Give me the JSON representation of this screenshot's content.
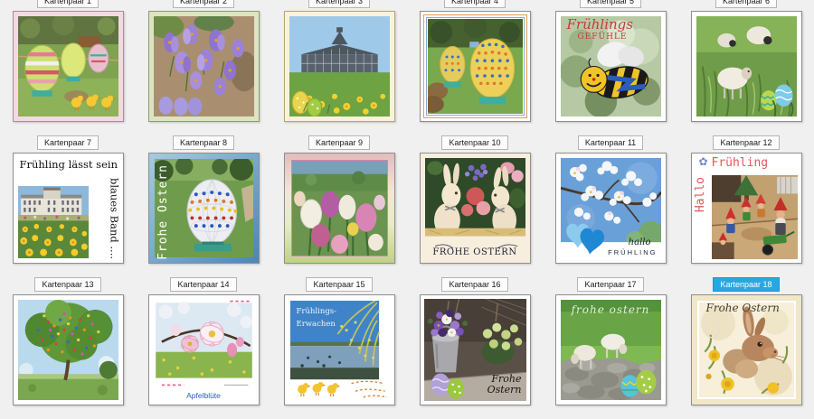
{
  "ui": {
    "background": "#f0f0f0",
    "label_bg": "#fcfcfc",
    "label_border": "#b4b4b4",
    "selected_bg": "#29a8e0",
    "selected_text": "#ffffff"
  },
  "cards": [
    {
      "label": "Kartenpaar 1",
      "alt": "decorated-easter-eggs-garden-chicks"
    },
    {
      "label": "Kartenpaar 2",
      "alt": "purple-crocus-field-eggs"
    },
    {
      "label": "Kartenpaar 3",
      "alt": "glasshouse-daffodils-eggs"
    },
    {
      "label": "Kartenpaar 4",
      "alt": "yellow-wire-eggs-lawn"
    },
    {
      "label": "Kartenpaar 5",
      "alt": "spring-bee-card",
      "texts": {
        "title": "Frühlings",
        "subtitle": "GEFÜHLE"
      }
    },
    {
      "label": "Kartenpaar 6",
      "alt": "sheep-meadow-eggs"
    },
    {
      "label": "Kartenpaar 7",
      "alt": "daffodils-palace-card",
      "texts": {
        "top": "Frühling lässt sein",
        "side": "blaues Band ...."
      }
    },
    {
      "label": "Kartenpaar 8",
      "alt": "bead-egg-card",
      "texts": {
        "side": "Frohe Ostern"
      }
    },
    {
      "label": "Kartenpaar 9",
      "alt": "tulip-field-card"
    },
    {
      "label": "Kartenpaar 10",
      "alt": "bunny-figurines-card",
      "texts": {
        "bottom": "FROHE OSTERN"
      }
    },
    {
      "label": "Kartenpaar 11",
      "alt": "apple-blossom-hearts-card",
      "texts": {
        "script": "hallo",
        "caps": "FRÜHLING"
      }
    },
    {
      "label": "Kartenpaar 12",
      "alt": "garden-gnomes-card",
      "texts": {
        "top": "Frühling",
        "side": "Hallo"
      }
    },
    {
      "label": "Kartenpaar 13",
      "alt": "easter-egg-tree"
    },
    {
      "label": "Kartenpaar 14",
      "alt": "apple-blossom-card",
      "texts": {
        "caption": "Apfelblüte"
      }
    },
    {
      "label": "Kartenpaar 15",
      "alt": "spring-lake-card",
      "texts": {
        "line1": "Frühlings-",
        "line2": "Erwachen"
      }
    },
    {
      "label": "Kartenpaar 16",
      "alt": "pansy-pot-card",
      "texts": {
        "line1": "Frohe",
        "line2": "Ostern"
      }
    },
    {
      "label": "Kartenpaar 17",
      "alt": "lambs-card",
      "texts": {
        "script": "frohe ostern"
      }
    },
    {
      "label": "Kartenpaar 18",
      "alt": "watercolor-hare-card",
      "selected": true,
      "texts": {
        "script": "Frohe Ostern"
      }
    }
  ]
}
